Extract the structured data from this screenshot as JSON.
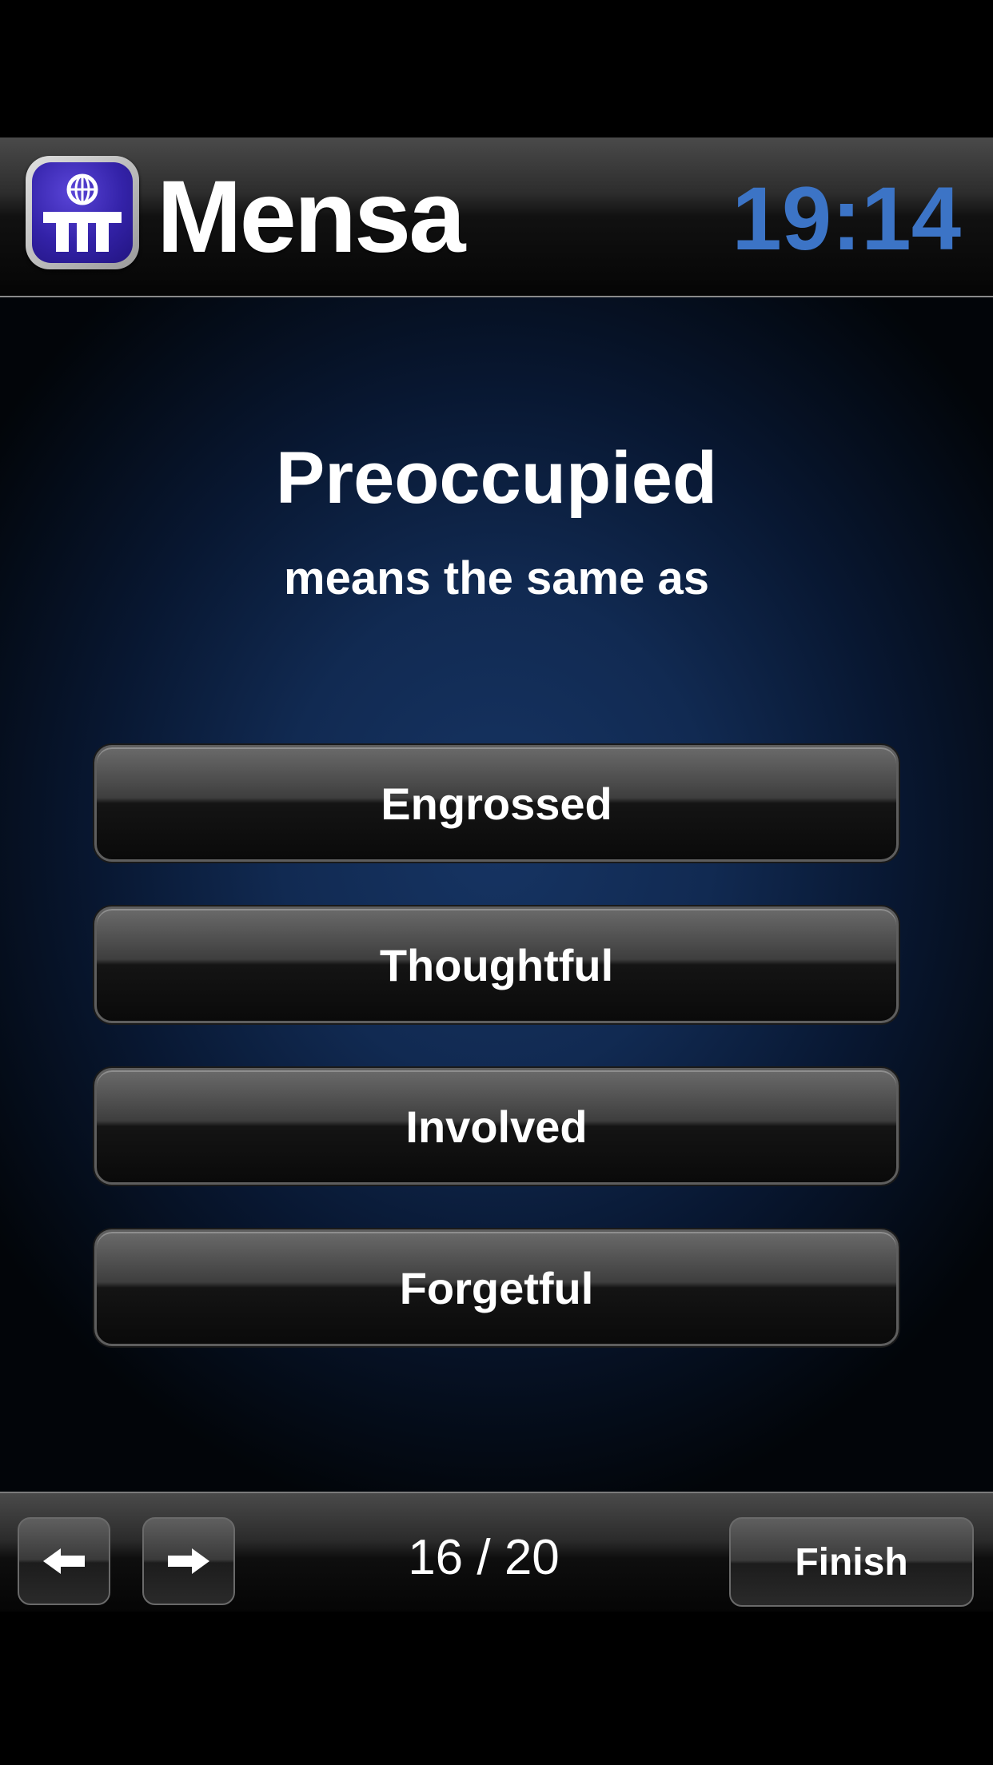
{
  "header": {
    "brand": "Mensa",
    "timer": "19:14",
    "logo_icon": "mensa-logo-icon",
    "timer_color": "#3c74c6"
  },
  "question": {
    "word": "Preoccupied",
    "prompt": "means the same as"
  },
  "answers": [
    {
      "label": "Engrossed"
    },
    {
      "label": "Thoughtful"
    },
    {
      "label": "Involved"
    },
    {
      "label": "Forgetful"
    }
  ],
  "footer": {
    "prev_icon": "arrow-left-icon",
    "next_icon": "arrow-right-icon",
    "progress": "16 / 20",
    "finish_label": "Finish"
  }
}
